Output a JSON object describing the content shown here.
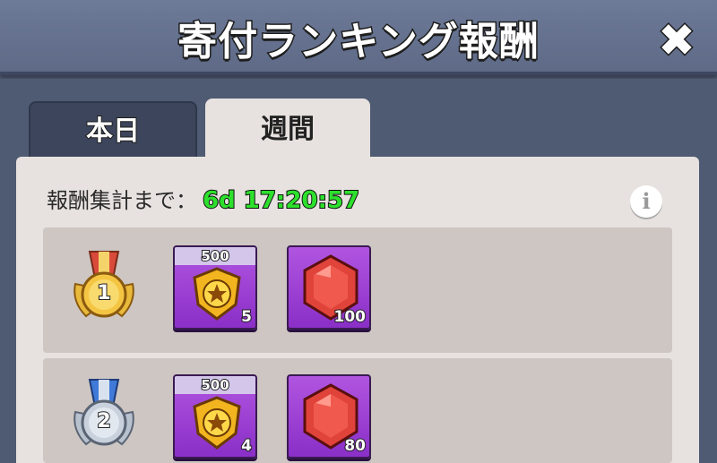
{
  "header": {
    "title": "寄付ランキング報酬",
    "close_symbol": "✖"
  },
  "tabs": [
    {
      "label": "本日",
      "active": false
    },
    {
      "label": "週間",
      "active": true
    }
  ],
  "timer": {
    "label": "報酬集計まで：",
    "value": "6d 17:20:57"
  },
  "info_icon": {
    "symbol": "i",
    "icon": "info-icon"
  },
  "ranks": [
    {
      "rank": "1",
      "medal": "gold-medal-icon",
      "rewards": [
        {
          "icon": "star-badge-icon",
          "top_label": "500",
          "quantity": "5"
        },
        {
          "icon": "red-gem-icon",
          "quantity": "100"
        }
      ]
    },
    {
      "rank": "2",
      "medal": "silver-medal-icon",
      "rewards": [
        {
          "icon": "star-badge-icon",
          "top_label": "500",
          "quantity": "4"
        },
        {
          "icon": "red-gem-icon",
          "quantity": "80"
        }
      ]
    }
  ],
  "colors": {
    "timer_green": "#2de02d",
    "reward_purple": "#9b3fd3",
    "panel_bg": "#e7e2df",
    "row_bg": "#cdc6c2"
  }
}
